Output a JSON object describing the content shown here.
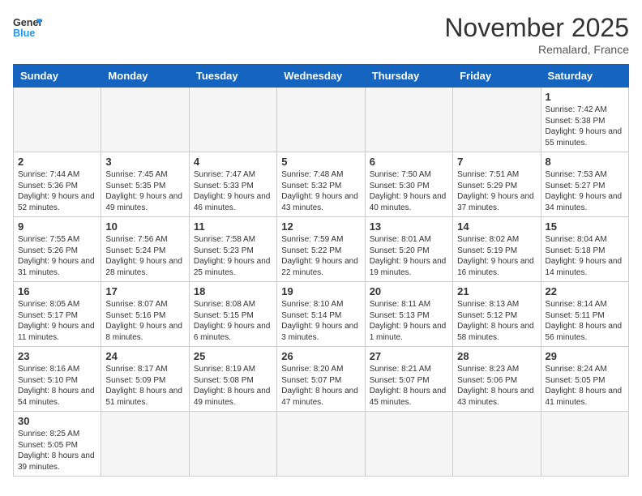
{
  "header": {
    "logo_general": "General",
    "logo_blue": "Blue",
    "month_title": "November 2025",
    "subtitle": "Remalard, France"
  },
  "days_of_week": [
    "Sunday",
    "Monday",
    "Tuesday",
    "Wednesday",
    "Thursday",
    "Friday",
    "Saturday"
  ],
  "weeks": [
    [
      {
        "day": "",
        "info": ""
      },
      {
        "day": "",
        "info": ""
      },
      {
        "day": "",
        "info": ""
      },
      {
        "day": "",
        "info": ""
      },
      {
        "day": "",
        "info": ""
      },
      {
        "day": "",
        "info": ""
      },
      {
        "day": "1",
        "info": "Sunrise: 7:42 AM\nSunset: 5:38 PM\nDaylight: 9 hours and 55 minutes."
      }
    ],
    [
      {
        "day": "2",
        "info": "Sunrise: 7:44 AM\nSunset: 5:36 PM\nDaylight: 9 hours and 52 minutes."
      },
      {
        "day": "3",
        "info": "Sunrise: 7:45 AM\nSunset: 5:35 PM\nDaylight: 9 hours and 49 minutes."
      },
      {
        "day": "4",
        "info": "Sunrise: 7:47 AM\nSunset: 5:33 PM\nDaylight: 9 hours and 46 minutes."
      },
      {
        "day": "5",
        "info": "Sunrise: 7:48 AM\nSunset: 5:32 PM\nDaylight: 9 hours and 43 minutes."
      },
      {
        "day": "6",
        "info": "Sunrise: 7:50 AM\nSunset: 5:30 PM\nDaylight: 9 hours and 40 minutes."
      },
      {
        "day": "7",
        "info": "Sunrise: 7:51 AM\nSunset: 5:29 PM\nDaylight: 9 hours and 37 minutes."
      },
      {
        "day": "8",
        "info": "Sunrise: 7:53 AM\nSunset: 5:27 PM\nDaylight: 9 hours and 34 minutes."
      }
    ],
    [
      {
        "day": "9",
        "info": "Sunrise: 7:55 AM\nSunset: 5:26 PM\nDaylight: 9 hours and 31 minutes."
      },
      {
        "day": "10",
        "info": "Sunrise: 7:56 AM\nSunset: 5:24 PM\nDaylight: 9 hours and 28 minutes."
      },
      {
        "day": "11",
        "info": "Sunrise: 7:58 AM\nSunset: 5:23 PM\nDaylight: 9 hours and 25 minutes."
      },
      {
        "day": "12",
        "info": "Sunrise: 7:59 AM\nSunset: 5:22 PM\nDaylight: 9 hours and 22 minutes."
      },
      {
        "day": "13",
        "info": "Sunrise: 8:01 AM\nSunset: 5:20 PM\nDaylight: 9 hours and 19 minutes."
      },
      {
        "day": "14",
        "info": "Sunrise: 8:02 AM\nSunset: 5:19 PM\nDaylight: 9 hours and 16 minutes."
      },
      {
        "day": "15",
        "info": "Sunrise: 8:04 AM\nSunset: 5:18 PM\nDaylight: 9 hours and 14 minutes."
      }
    ],
    [
      {
        "day": "16",
        "info": "Sunrise: 8:05 AM\nSunset: 5:17 PM\nDaylight: 9 hours and 11 minutes."
      },
      {
        "day": "17",
        "info": "Sunrise: 8:07 AM\nSunset: 5:16 PM\nDaylight: 9 hours and 8 minutes."
      },
      {
        "day": "18",
        "info": "Sunrise: 8:08 AM\nSunset: 5:15 PM\nDaylight: 9 hours and 6 minutes."
      },
      {
        "day": "19",
        "info": "Sunrise: 8:10 AM\nSunset: 5:14 PM\nDaylight: 9 hours and 3 minutes."
      },
      {
        "day": "20",
        "info": "Sunrise: 8:11 AM\nSunset: 5:13 PM\nDaylight: 9 hours and 1 minute."
      },
      {
        "day": "21",
        "info": "Sunrise: 8:13 AM\nSunset: 5:12 PM\nDaylight: 8 hours and 58 minutes."
      },
      {
        "day": "22",
        "info": "Sunrise: 8:14 AM\nSunset: 5:11 PM\nDaylight: 8 hours and 56 minutes."
      }
    ],
    [
      {
        "day": "23",
        "info": "Sunrise: 8:16 AM\nSunset: 5:10 PM\nDaylight: 8 hours and 54 minutes."
      },
      {
        "day": "24",
        "info": "Sunrise: 8:17 AM\nSunset: 5:09 PM\nDaylight: 8 hours and 51 minutes."
      },
      {
        "day": "25",
        "info": "Sunrise: 8:19 AM\nSunset: 5:08 PM\nDaylight: 8 hours and 49 minutes."
      },
      {
        "day": "26",
        "info": "Sunrise: 8:20 AM\nSunset: 5:07 PM\nDaylight: 8 hours and 47 minutes."
      },
      {
        "day": "27",
        "info": "Sunrise: 8:21 AM\nSunset: 5:07 PM\nDaylight: 8 hours and 45 minutes."
      },
      {
        "day": "28",
        "info": "Sunrise: 8:23 AM\nSunset: 5:06 PM\nDaylight: 8 hours and 43 minutes."
      },
      {
        "day": "29",
        "info": "Sunrise: 8:24 AM\nSunset: 5:05 PM\nDaylight: 8 hours and 41 minutes."
      }
    ],
    [
      {
        "day": "30",
        "info": "Sunrise: 8:25 AM\nSunset: 5:05 PM\nDaylight: 8 hours and 39 minutes."
      },
      {
        "day": "",
        "info": ""
      },
      {
        "day": "",
        "info": ""
      },
      {
        "day": "",
        "info": ""
      },
      {
        "day": "",
        "info": ""
      },
      {
        "day": "",
        "info": ""
      },
      {
        "day": "",
        "info": ""
      }
    ]
  ]
}
